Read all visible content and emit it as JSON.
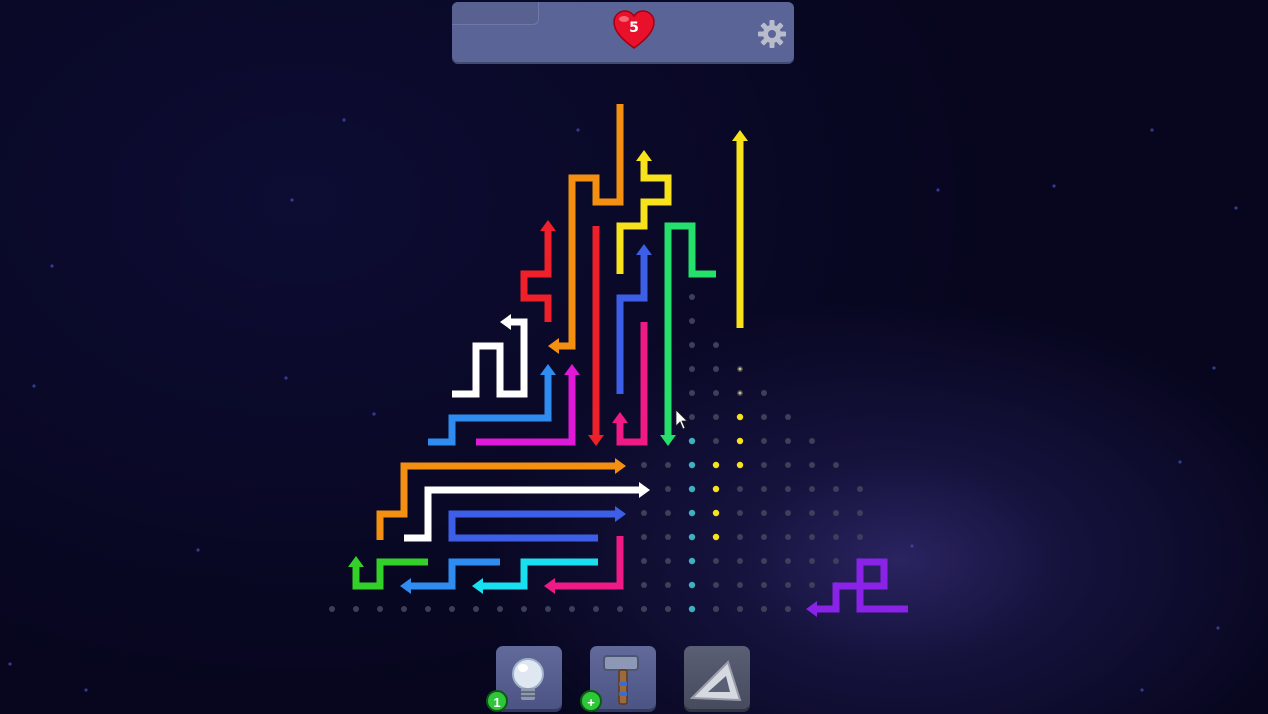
{
  "header": {
    "lives": "5",
    "settings_icon": "gear-icon",
    "heart_icon": "heart-icon"
  },
  "toolbar": {
    "hint_badge": "1",
    "hammer_badge": "+",
    "hint_icon": "lightbulb-icon",
    "hammer_icon": "hammer-icon",
    "erase_icon": "triangle-ruler-icon"
  },
  "colors": {
    "orange": "#f39012",
    "yellow": "#f7e21c",
    "red": "#f0202a",
    "green": "#25e06a",
    "blue": "#3d5fe8",
    "pink": "#f01a86",
    "white": "#ffffff",
    "skyblue": "#2f8cf0",
    "magenta": "#e018d8",
    "cyan": "#18e0f0",
    "lime": "#32d028",
    "purple": "#8a22e8"
  },
  "pointer_icon": "cursor-icon"
}
